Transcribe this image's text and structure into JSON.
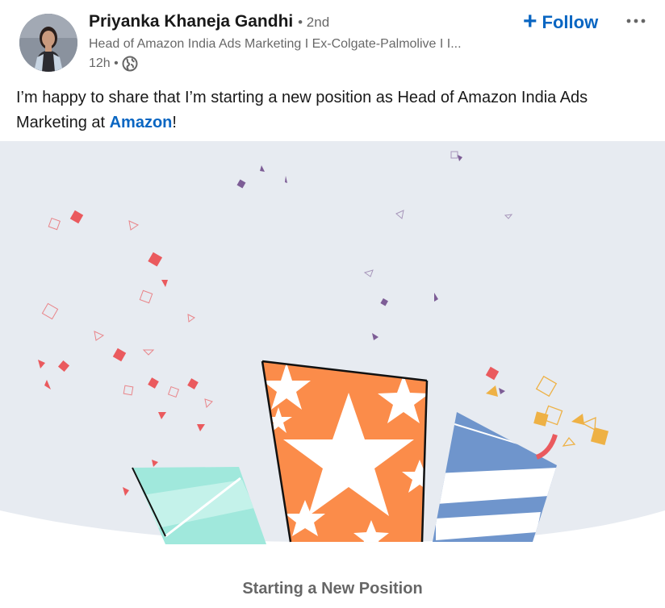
{
  "actor": {
    "name": "Priyanka Khaneja Gandhi",
    "degree": "• 2nd",
    "headline": "Head of Amazon India Ads Marketing I Ex-Colgate-Palmolive I I...",
    "time": "12h •",
    "visibility_icon": "globe-icon"
  },
  "actions": {
    "follow_label": "Follow",
    "follow_icon": "plus-icon",
    "more_icon": "ellipsis-icon"
  },
  "post": {
    "text_before": "I’m happy to share that I’m starting a new position as Head of Amazon India Ads Marketing at ",
    "mention": "Amazon",
    "text_after": "!"
  },
  "celebration": {
    "caption": "Starting a New Position"
  },
  "colors": {
    "brand_blue": "#0a66c2",
    "background_blue_gray": "#e7ebf1",
    "orange": "#fb8c4a",
    "teal": "#a0e8dc",
    "blue_stripe": "#6f95cc",
    "confetti_red": "#ea5a5e",
    "confetti_yellow": "#eeb145",
    "confetti_purple": "#7d5d96"
  }
}
